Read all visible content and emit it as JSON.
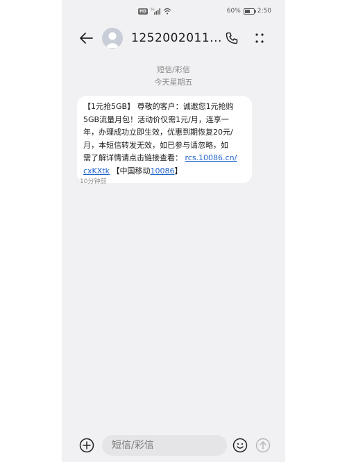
{
  "status_bar": {
    "hd_label": "HD",
    "network": "5G",
    "battery_text": "60%",
    "battery_level": 0.6,
    "time": "2:50"
  },
  "header": {
    "contact_name": "1252002011..."
  },
  "thread": {
    "type_label": "短信/彩信",
    "date_label": "今天星期五"
  },
  "message": {
    "lines": [
      "【1元抢5GB】 尊敬的客户：诚邀您1元抢购",
      "5GB流量月包！活动价仅需1元/月，连享一",
      "年，办理成功立即生效，优惠到期恢复20元/",
      "月，本短信转发无效，如已参与请忽略，如",
      "需了解详情请点击链接查看："
    ],
    "link_part1": "rcs.10086.cn/",
    "link_part2": "cxKXtk",
    "signature_prefix": " 【中国移动",
    "signature_number": "10086",
    "signature_suffix": "】",
    "time": "10分钟前"
  },
  "compose": {
    "placeholder": "短信/彩信"
  },
  "icons": {
    "back": "arrow-left-icon",
    "avatar": "person-icon",
    "call": "phone-icon",
    "more": "more-dots-icon",
    "add": "plus-circle-icon",
    "emoji": "smiley-icon",
    "send": "arrow-up-circle-icon"
  },
  "colors": {
    "link": "#1f64c9",
    "background": "#f1f1f3",
    "bubble": "#ffffff"
  }
}
